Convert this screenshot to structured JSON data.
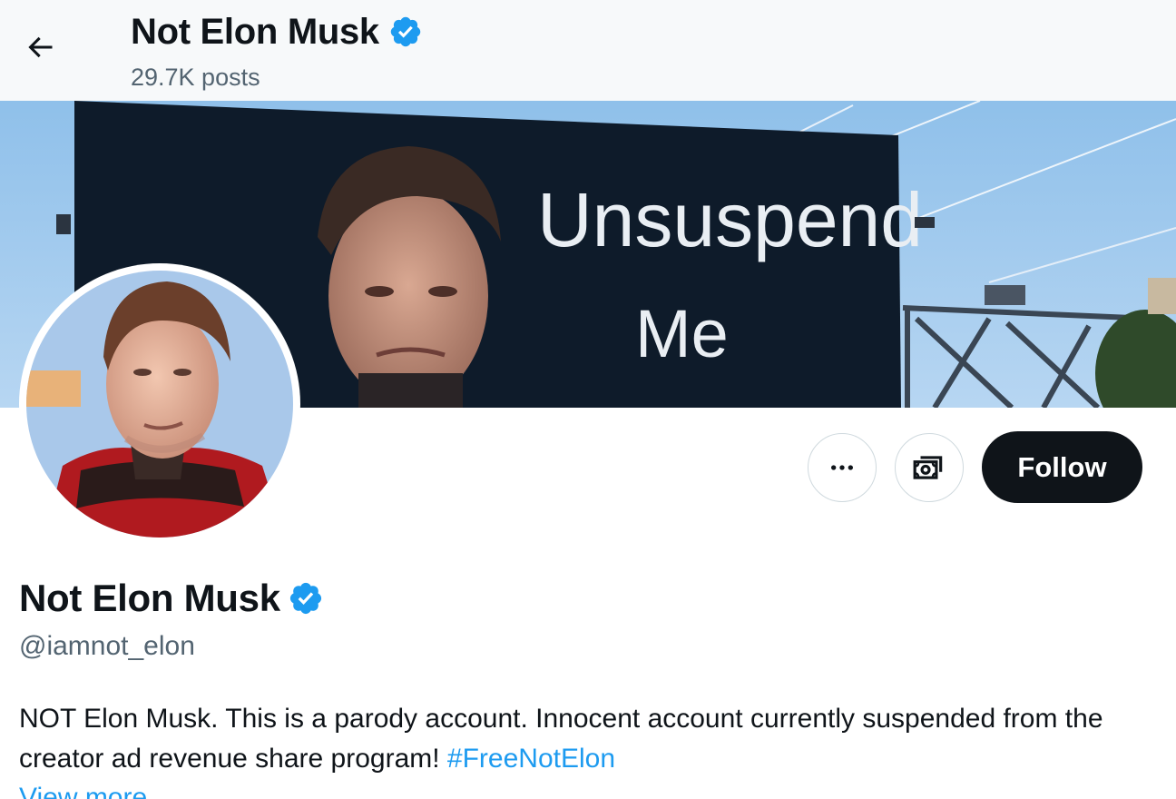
{
  "header": {
    "title": "Not Elon Musk",
    "post_count": "29.7K posts"
  },
  "banner": {
    "billboard_line1": "Unsuspend",
    "billboard_line2": "Me"
  },
  "actions": {
    "more_icon": "more-horizontal-icon",
    "subscribe_icon": "money-icon",
    "follow_label": "Follow"
  },
  "profile": {
    "display_name": "Not Elon Musk",
    "handle": "@iamnot_elon",
    "bio_text": "NOT Elon Musk. This is a parody account. Innocent account currently suspended from the creator ad revenue share program! ",
    "bio_hashtag": "#FreeNotElon",
    "view_more": "View more"
  },
  "colors": {
    "verified": "#1d9bf0",
    "link": "#1d9bf0",
    "follow_bg": "#0f1419",
    "secondary_text": "#536471"
  }
}
